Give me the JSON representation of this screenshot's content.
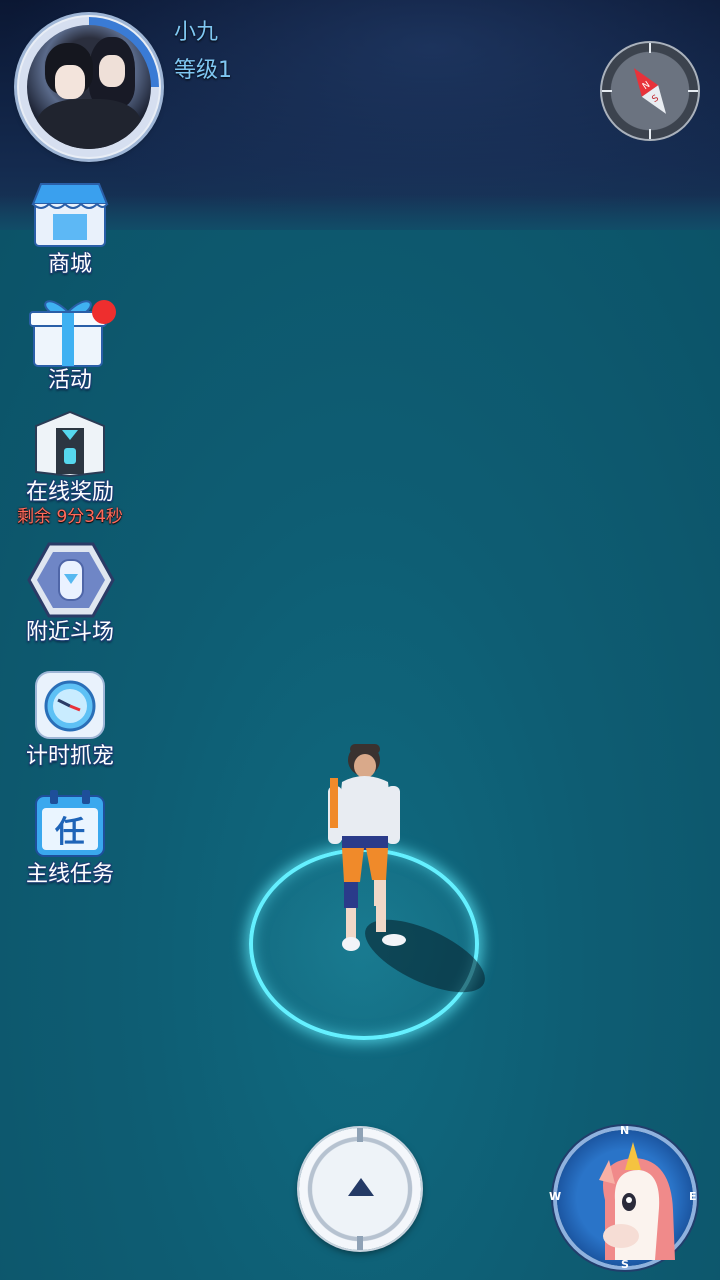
{
  "player": {
    "name": "小九",
    "level": "等级1"
  },
  "menu": [
    {
      "id": "shop",
      "label": "商城",
      "icon": "shop-icon"
    },
    {
      "id": "events",
      "label": "活动",
      "icon": "gift-icon",
      "badge": true
    },
    {
      "id": "online-reward",
      "label": "在线奖励",
      "icon": "reward-chest-icon",
      "timer": "剩余 9分34秒"
    },
    {
      "id": "nearby-arena",
      "label": "附近斗场",
      "icon": "arena-icon"
    },
    {
      "id": "timed-catch",
      "label": "计时抓宠",
      "icon": "stopwatch-icon"
    },
    {
      "id": "main-quest",
      "label": "主线任务",
      "icon": "quest-calendar-icon",
      "icon_char": "任"
    }
  ],
  "compass": {
    "north": "N",
    "south": "S"
  },
  "radar": {
    "n": "N",
    "s": "S",
    "e": "E",
    "w": "W"
  },
  "colors": {
    "ring": "#64f0ff",
    "timer": "#ff6a5a",
    "name": "#7fc7f2"
  }
}
